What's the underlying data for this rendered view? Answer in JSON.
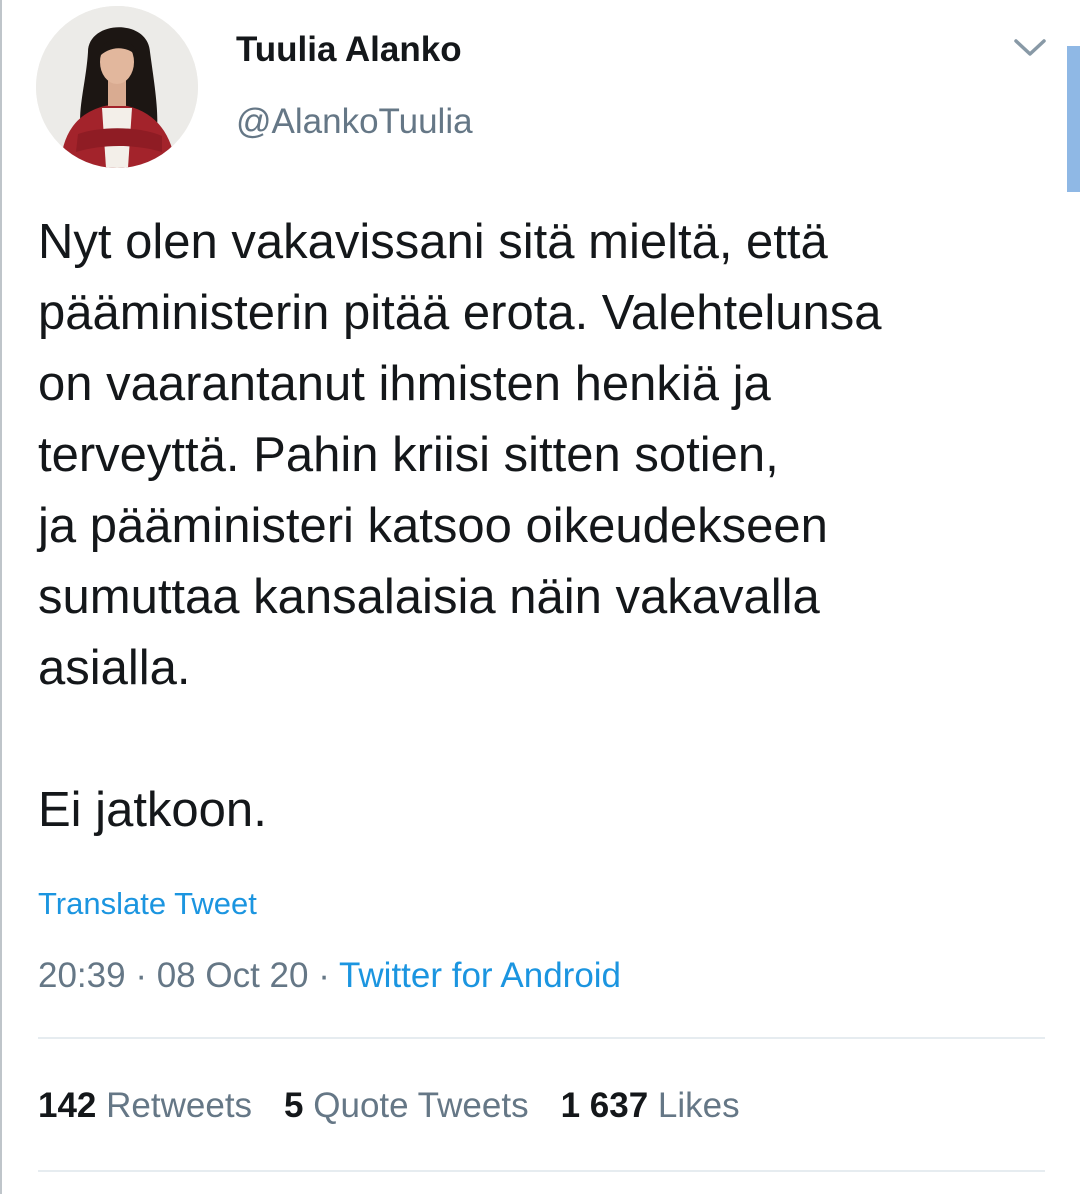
{
  "tweet": {
    "display_name": "Tuulia Alanko",
    "handle": "@AlankoTuulia",
    "text": "Nyt olen vakavissani sitä mieltä, että\npääministerin pitää erota. Valehtelunsa\non vaarantanut ihmisten henkiä ja\nterveyttä. Pahin kriisi sitten sotien,\nja pääministeri katsoo oikeudekseen\nsumuttaa kansalaisia näin vakavalla\nasialla.\n\nEi jatkoon.",
    "translate_label": "Translate Tweet",
    "time": "20:39",
    "separator": " · ",
    "date": "08 Oct 20",
    "source": "Twitter for Android",
    "stats": [
      {
        "count": "142",
        "label": "Retweets"
      },
      {
        "count": "5",
        "label": "Quote Tweets"
      },
      {
        "count": "1 637",
        "label": "Likes"
      }
    ]
  },
  "icons": {
    "avatar": "profile-photo",
    "caret": "chevron-down-icon"
  },
  "colors": {
    "text_primary": "#14171a",
    "text_secondary": "#657786",
    "link": "#1b95e0",
    "divider": "#e6ecf0"
  }
}
